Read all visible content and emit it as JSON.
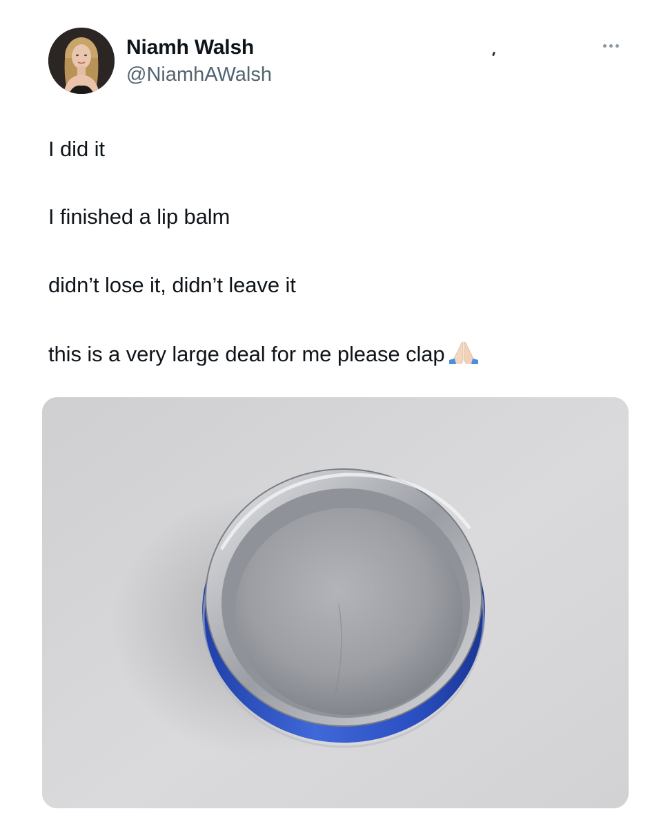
{
  "author": {
    "name": "Niamh Walsh",
    "handle": "@NiamhAWalsh",
    "avatar_icon": "profile-photo"
  },
  "menu": {
    "more_icon": "ellipsis-icon"
  },
  "tweet": {
    "lines": [
      "I did it",
      "I finished a lip balm",
      "didn’t lose it, didn’t leave it",
      "this is a very large deal for me please clap"
    ],
    "emoji": "folded-hands-emoji"
  },
  "media": {
    "subject": "empty-lip-balm-tin-photo"
  },
  "colors": {
    "text": "#0f1419",
    "secondary": "#536471",
    "tin_blue": "#2f55c8"
  }
}
